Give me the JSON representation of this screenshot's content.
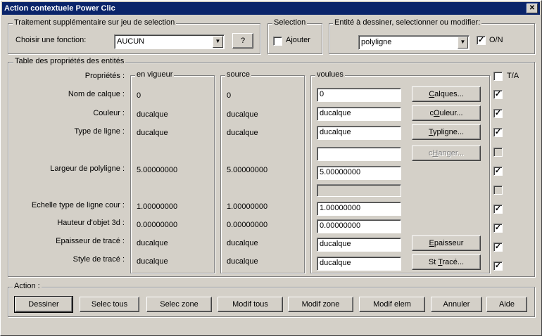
{
  "window": {
    "title": "Action contextuele Power Clic",
    "close_glyph": "✕"
  },
  "selection_group": {
    "title": "Traitement supplémentaire sur jeu de selection",
    "label": "Choisir une fonction:",
    "value": "AUCUN",
    "help_button": "?"
  },
  "selection_box": {
    "title": "Selection",
    "ajouter_label": "Ajouter",
    "ajouter_checked": false
  },
  "entity_group": {
    "title": "Entité à dessiner, selectionner ou modifier:",
    "value": "polyligne",
    "on_label": "O/N",
    "on_checked": true
  },
  "table": {
    "title": "Table des propriétés des entités",
    "props_header": "Propriétés :",
    "vigueur_header": "en vigueur",
    "source_header": "source",
    "voulues_header": "voulues",
    "ta_label": "T/A",
    "ta_checked": false,
    "rows": [
      {
        "label": "Nom de calque :",
        "vigueur": "0",
        "source": "0",
        "voulue": "0",
        "button": "Calques...",
        "checked": true
      },
      {
        "label": "Couleur :",
        "vigueur": "ducalque",
        "source": "ducalque",
        "voulue": "ducalque",
        "button": "cOuleur...",
        "checked": true
      },
      {
        "label": "Type de ligne :",
        "vigueur": "ducalque",
        "source": "ducalque",
        "voulue": "ducalque",
        "button": "Typligne...",
        "checked": true
      },
      {
        "label": "",
        "vigueur": "",
        "source": "",
        "voulue": "",
        "button": "cHanger...",
        "checked": false
      },
      {
        "label": "Largeur de polyligne :",
        "vigueur": "5.00000000",
        "source": "5.00000000",
        "voulue": "5.00000000",
        "button": "",
        "checked": true
      },
      {
        "label": "",
        "vigueur": "",
        "source": "",
        "voulue": "",
        "button": "",
        "checked": false
      },
      {
        "label": "Echelle type de ligne cour :",
        "vigueur": "1.00000000",
        "source": "1.00000000",
        "voulue": "1.00000000",
        "button": "",
        "checked": true
      },
      {
        "label": "Hauteur d'objet 3d :",
        "vigueur": "0.00000000",
        "source": "0.00000000",
        "voulue": "0.00000000",
        "button": "",
        "checked": true
      },
      {
        "label": "Epaisseur de tracé :",
        "vigueur": "ducalque",
        "source": "ducalque",
        "voulue": "ducalque",
        "button": "Epaisseur",
        "checked": true
      },
      {
        "label": "Style de tracé :",
        "vigueur": "ducalque",
        "source": "ducalque",
        "voulue": "ducalque",
        "button": "St Tracé...",
        "checked": true
      }
    ]
  },
  "action": {
    "title": "Action :",
    "buttons": [
      "Dessiner",
      "Selec tous",
      "Selec zone",
      "Modif tous",
      "Modif zone",
      "Modif elem",
      "Annuler",
      "Aide"
    ]
  },
  "check_glyph": "✓",
  "arrow_glyph": "▼"
}
